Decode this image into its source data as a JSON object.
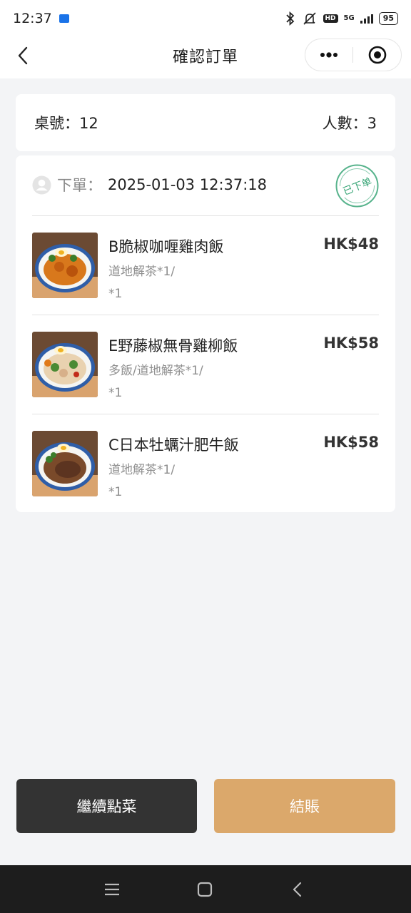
{
  "status_bar": {
    "time": "12:37",
    "hd": "HD",
    "network": "5G",
    "battery": "95"
  },
  "nav": {
    "title": "確認訂單"
  },
  "table_info": {
    "table_label": "桌號：12",
    "people_label": "人數：3"
  },
  "order": {
    "time_label": "下單：",
    "time_value": "2025-01-03 12:37:18",
    "stamp_text": "已下单",
    "items": [
      {
        "name": "B脆椒咖喱雞肉飯",
        "options": "道地解茶*1/",
        "qty": "*1",
        "price": "HK$48"
      },
      {
        "name": "E野藤椒無骨雞柳飯",
        "options": "多飯/道地解茶*1/",
        "qty": "*1",
        "price": "HK$58"
      },
      {
        "name": "C日本牡蠣汁肥牛飯",
        "options": "道地解茶*1/",
        "qty": "*1",
        "price": "HK$58"
      }
    ]
  },
  "buttons": {
    "continue": "繼續點菜",
    "checkout": "結賬"
  },
  "colors": {
    "checkout": "#dba86b",
    "continue": "#333333",
    "stamp": "#3aa678"
  }
}
